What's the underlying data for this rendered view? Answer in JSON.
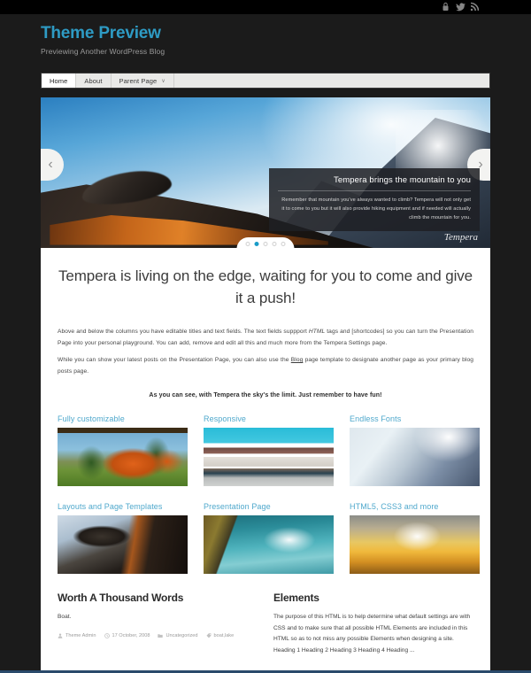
{
  "topbar": {
    "icons": [
      {
        "name": "login-icon",
        "title": "Log in"
      },
      {
        "name": "twitter-icon",
        "title": "Twitter"
      },
      {
        "name": "rss-icon",
        "title": "RSS Feed"
      }
    ]
  },
  "header": {
    "site_title": "Theme Preview",
    "site_description": "Previewing Another WordPress Blog"
  },
  "nav": {
    "items": [
      {
        "label": "Home",
        "active": true,
        "has_dropdown": false
      },
      {
        "label": "About",
        "active": false,
        "has_dropdown": false
      },
      {
        "label": "Parent Page",
        "active": false,
        "has_dropdown": true
      }
    ],
    "caret": "∨"
  },
  "slider": {
    "prev_label": "‹",
    "next_label": "›",
    "caption_title": "Tempera brings the mountain to you",
    "caption_text": "Remember that mountain you've always wanted to climb? Tempera will not only get it to come to you but it will also provide hiking equipment and if needed will actually climb the mountain for you.",
    "brand": "Tempera",
    "dot_count": 5,
    "active_dot": 2,
    "accent_color": "#1a9cc8"
  },
  "main": {
    "headline": "Tempera is living on the edge, waiting for you to come and give it a push!",
    "paragraph_1_a": "Above and below the columns you have editable titles and text fields. The text fields suppport ",
    "paragraph_1_em": "HTML",
    "paragraph_1_b": " tags and [shortcodes] so you can turn the Presentation Page into your personal playground. You can add, remove and edit all this and much more from the Tempera Settings page.",
    "paragraph_2_a": "While you can show your latest posts on the Presentation Page, you can also use the ",
    "paragraph_2_link": "Blog",
    "paragraph_2_b": " page template to designate another page as your primary blog posts page.",
    "tagline": "As you can see, with Tempera the sky's the limit. Just remember to have fun!"
  },
  "features": {
    "row1": [
      {
        "title": "Fully customizable",
        "image": "autumn-park-photo"
      },
      {
        "title": "Responsive",
        "image": "snow-mountain-lake-photo"
      },
      {
        "title": "Endless Fonts",
        "image": "foggy-mountain-photo"
      }
    ],
    "row2": [
      {
        "title": "Layouts and Page Templates",
        "image": "rock-formation-photo"
      },
      {
        "title": "Presentation Page",
        "image": "coastal-cove-photo"
      },
      {
        "title": "HTML5, CSS3 and more",
        "image": "golden-sunset-photo"
      }
    ]
  },
  "posts": {
    "left": {
      "title": "Worth A Thousand Words",
      "excerpt": "Boat.",
      "meta": {
        "author": "Theme Admin",
        "date": "17 October, 2008",
        "category": "Uncategorized",
        "tags": "boat,lake"
      }
    },
    "right": {
      "title": "Elements",
      "excerpt": "The purpose of this HTML is to help determine what default settings are with CSS and to make sure that all possible HTML Elements are included in this HTML so as to not miss any possible Elements when designing a site. Heading 1 Heading 2 Heading 3 Heading 4 Heading ..."
    }
  }
}
